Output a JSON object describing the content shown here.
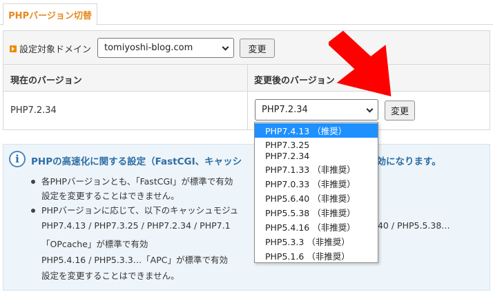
{
  "tab": {
    "label": "PHPバージョン切替"
  },
  "domain_row": {
    "label": "設定対象ドメイン",
    "selected": "tomiyoshi-blog.com",
    "change_button": "変更"
  },
  "table": {
    "header_current": "現在のバージョン",
    "header_new": "変更後のバージョン",
    "current_version": "PHP7.2.34",
    "new_version_selected": "PHP7.2.34",
    "change_button": "変更"
  },
  "version_options": [
    "PHP7.4.13 （推奨）",
    "PHP7.3.25",
    "PHP7.2.34",
    "PHP7.1.33 （非推奨）",
    "PHP7.0.33 （非推奨）",
    "PHP5.6.40 （非推奨）",
    "PHP5.5.38 （非推奨）",
    "PHP5.4.16 （非推奨）",
    "PHP5.3.3 （非推奨）",
    "PHP5.1.6 （非推奨）"
  ],
  "highlighted_option_index": 0,
  "info": {
    "title_left": "PHPの高速化に関する設定（FastCGI、キャッシ",
    "title_right": "効になります。",
    "b1_line1_left": "各PHPバージョンとも、「FastCGI」が標準で有効",
    "b1_line2": "設定を変更することはできません。",
    "b2_line1_left": "PHPバージョンに応じて、以下のキャッシュモジュ",
    "b2_line2_left": "PHP7.4.13 / PHP7.3.25 / PHP7.2.34 / PHP7.1",
    "b2_line2_right": ".40 / PHP5.5.38…",
    "b2_line3": "「OPcache」が標準で有効",
    "b2_line4": "PHP5.4.16 / PHP5.3.3…「APC」が標準で有効",
    "b2_line5": "設定を変更することはできません。"
  },
  "colors": {
    "tab_text": "#e8891d",
    "info_title": "#2d6ea6",
    "selected_option_bg": "#1e90ff",
    "annotation_arrow": "#ff0000"
  },
  "icons": [
    "orange-square-icon",
    "info-icon",
    "chevron-down-icon",
    "red-arrow-annotation"
  ]
}
